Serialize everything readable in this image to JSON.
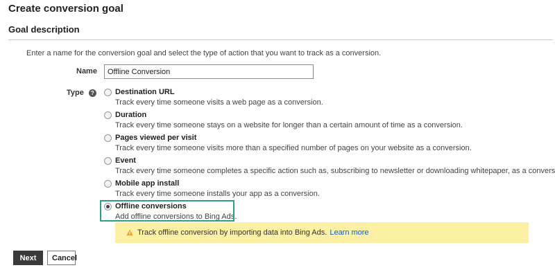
{
  "page": {
    "title": "Create conversion goal",
    "section_title": "Goal description",
    "intro": "Enter a name for the conversion goal and select the type of action that you want to track as a conversion."
  },
  "name_field": {
    "label": "Name",
    "value": "Offline Conversion"
  },
  "type_field": {
    "label": "Type",
    "help_icon": "question-circle-icon",
    "options": [
      {
        "title": "Destination URL",
        "description": "Track every time someone visits a web page as a conversion.",
        "selected": false
      },
      {
        "title": "Duration",
        "description": "Track every time someone stays on a website for longer than a certain amount of time as a conversion.",
        "selected": false
      },
      {
        "title": "Pages viewed per visit",
        "description": "Track every time someone visits more than a specified number of pages on your website as a conversion.",
        "selected": false
      },
      {
        "title": "Event",
        "description": "Track every time someone completes a specific action such as, subscribing to newsletter or downloading whitepaper, as a conversion.",
        "selected": false
      },
      {
        "title": "Mobile app install",
        "description": "Track every time someone installs your app as a conversion.",
        "selected": false
      },
      {
        "title": "Offline conversions",
        "description": "Add offline conversions to Bing Ads.",
        "selected": true
      }
    ]
  },
  "notice": {
    "icon": "warning-triangle-icon",
    "text": "Track offline conversion by importing data into Bing Ads.",
    "link": "Learn more"
  },
  "actions": {
    "next_label": "Next",
    "cancel_label": "Cancel"
  },
  "colors": {
    "selected_outline": "#2f9e85",
    "notice_background": "#fcf0a4",
    "warning_icon": "#f0a020",
    "link": "#1a5fb4"
  }
}
